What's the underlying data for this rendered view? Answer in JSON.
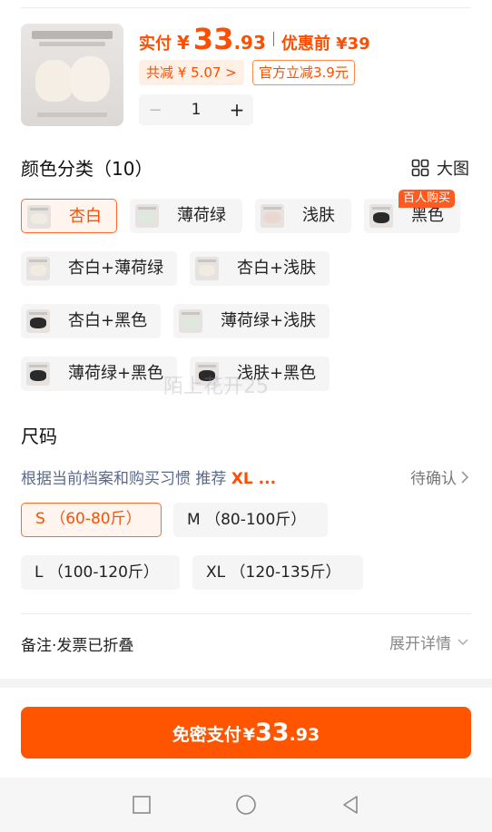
{
  "product": {
    "price_label": "实付",
    "currency": "¥",
    "price_int": "33",
    "price_dec": ".93",
    "original_price": "优惠前 ¥39",
    "total_discount": "共减 ¥ 5.07 >",
    "official_discount": "官方立减3.9元",
    "quantity": "1",
    "minus_symbol": "−",
    "plus_symbol": "+"
  },
  "color_section": {
    "title": "颜色分类（10）",
    "big_image_label": "大图",
    "badge": "百人购买",
    "options": [
      {
        "label": "杏白"
      },
      {
        "label": "薄荷绿"
      },
      {
        "label": "浅肤"
      },
      {
        "label": "黑色"
      },
      {
        "label": "杏白+薄荷绿"
      },
      {
        "label": "杏白+浅肤"
      },
      {
        "label": "杏白+黑色"
      },
      {
        "label": "薄荷绿+浅肤"
      },
      {
        "label": "薄荷绿+黑色"
      },
      {
        "label": "浅肤+黑色"
      }
    ]
  },
  "watermark": "陌上花开25",
  "size_section": {
    "title": "尺码",
    "recommend_text": "根据当前档案和购买习惯 推荐 ",
    "recommend_size": "XL ...",
    "pending_label": "待确认",
    "options": [
      {
        "label": "S （60-80斤）"
      },
      {
        "label": "M （80-100斤）"
      },
      {
        "label": "L （100-120斤）"
      },
      {
        "label": "XL （120-135斤）"
      }
    ]
  },
  "remark": {
    "label": "备注·发票已折叠",
    "expand_label": "展开详情"
  },
  "pay_button": {
    "label": "免密支付",
    "currency": "¥",
    "price_int": "33",
    "price_dec": ".93"
  },
  "colors": {
    "accent": "#ff5500",
    "accent_light": "#fff4ee",
    "chip_bg": "#f5f5f5"
  }
}
